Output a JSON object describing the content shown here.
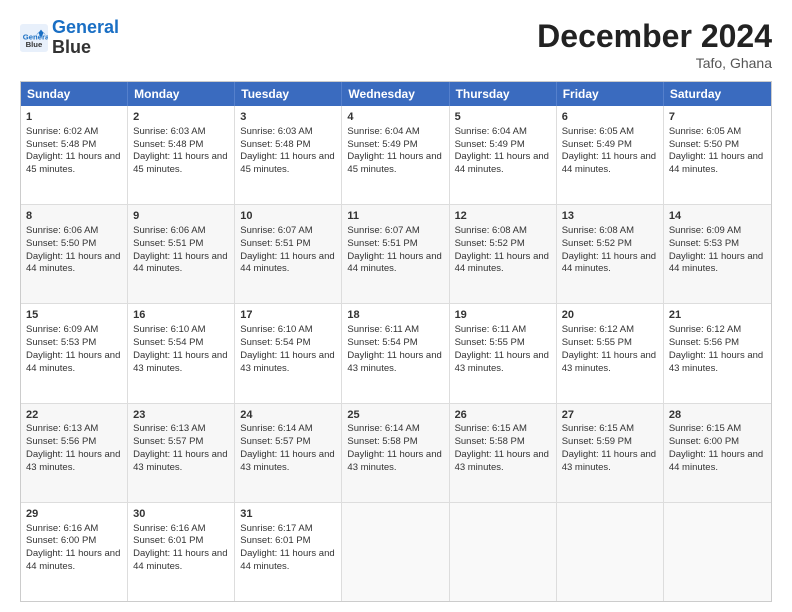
{
  "logo": {
    "line1": "General",
    "line2": "Blue"
  },
  "title": "December 2024",
  "location": "Tafo, Ghana",
  "days": [
    "Sunday",
    "Monday",
    "Tuesday",
    "Wednesday",
    "Thursday",
    "Friday",
    "Saturday"
  ],
  "weeks": [
    [
      {
        "day": 1,
        "rise": "6:02 AM",
        "set": "5:48 PM",
        "hours": "11 hours and 45 minutes."
      },
      {
        "day": 2,
        "rise": "6:03 AM",
        "set": "5:48 PM",
        "hours": "11 hours and 45 minutes."
      },
      {
        "day": 3,
        "rise": "6:03 AM",
        "set": "5:48 PM",
        "hours": "11 hours and 45 minutes."
      },
      {
        "day": 4,
        "rise": "6:04 AM",
        "set": "5:49 PM",
        "hours": "11 hours and 45 minutes."
      },
      {
        "day": 5,
        "rise": "6:04 AM",
        "set": "5:49 PM",
        "hours": "11 hours and 44 minutes."
      },
      {
        "day": 6,
        "rise": "6:05 AM",
        "set": "5:49 PM",
        "hours": "11 hours and 44 minutes."
      },
      {
        "day": 7,
        "rise": "6:05 AM",
        "set": "5:50 PM",
        "hours": "11 hours and 44 minutes."
      }
    ],
    [
      {
        "day": 8,
        "rise": "6:06 AM",
        "set": "5:50 PM",
        "hours": "11 hours and 44 minutes."
      },
      {
        "day": 9,
        "rise": "6:06 AM",
        "set": "5:51 PM",
        "hours": "11 hours and 44 minutes."
      },
      {
        "day": 10,
        "rise": "6:07 AM",
        "set": "5:51 PM",
        "hours": "11 hours and 44 minutes."
      },
      {
        "day": 11,
        "rise": "6:07 AM",
        "set": "5:51 PM",
        "hours": "11 hours and 44 minutes."
      },
      {
        "day": 12,
        "rise": "6:08 AM",
        "set": "5:52 PM",
        "hours": "11 hours and 44 minutes."
      },
      {
        "day": 13,
        "rise": "6:08 AM",
        "set": "5:52 PM",
        "hours": "11 hours and 44 minutes."
      },
      {
        "day": 14,
        "rise": "6:09 AM",
        "set": "5:53 PM",
        "hours": "11 hours and 44 minutes."
      }
    ],
    [
      {
        "day": 15,
        "rise": "6:09 AM",
        "set": "5:53 PM",
        "hours": "11 hours and 44 minutes."
      },
      {
        "day": 16,
        "rise": "6:10 AM",
        "set": "5:54 PM",
        "hours": "11 hours and 43 minutes."
      },
      {
        "day": 17,
        "rise": "6:10 AM",
        "set": "5:54 PM",
        "hours": "11 hours and 43 minutes."
      },
      {
        "day": 18,
        "rise": "6:11 AM",
        "set": "5:54 PM",
        "hours": "11 hours and 43 minutes."
      },
      {
        "day": 19,
        "rise": "6:11 AM",
        "set": "5:55 PM",
        "hours": "11 hours and 43 minutes."
      },
      {
        "day": 20,
        "rise": "6:12 AM",
        "set": "5:55 PM",
        "hours": "11 hours and 43 minutes."
      },
      {
        "day": 21,
        "rise": "6:12 AM",
        "set": "5:56 PM",
        "hours": "11 hours and 43 minutes."
      }
    ],
    [
      {
        "day": 22,
        "rise": "6:13 AM",
        "set": "5:56 PM",
        "hours": "11 hours and 43 minutes."
      },
      {
        "day": 23,
        "rise": "6:13 AM",
        "set": "5:57 PM",
        "hours": "11 hours and 43 minutes."
      },
      {
        "day": 24,
        "rise": "6:14 AM",
        "set": "5:57 PM",
        "hours": "11 hours and 43 minutes."
      },
      {
        "day": 25,
        "rise": "6:14 AM",
        "set": "5:58 PM",
        "hours": "11 hours and 43 minutes."
      },
      {
        "day": 26,
        "rise": "6:15 AM",
        "set": "5:58 PM",
        "hours": "11 hours and 43 minutes."
      },
      {
        "day": 27,
        "rise": "6:15 AM",
        "set": "5:59 PM",
        "hours": "11 hours and 43 minutes."
      },
      {
        "day": 28,
        "rise": "6:15 AM",
        "set": "6:00 PM",
        "hours": "11 hours and 44 minutes."
      }
    ],
    [
      {
        "day": 29,
        "rise": "6:16 AM",
        "set": "6:00 PM",
        "hours": "11 hours and 44 minutes."
      },
      {
        "day": 30,
        "rise": "6:16 AM",
        "set": "6:01 PM",
        "hours": "11 hours and 44 minutes."
      },
      {
        "day": 31,
        "rise": "6:17 AM",
        "set": "6:01 PM",
        "hours": "11 hours and 44 minutes."
      },
      null,
      null,
      null,
      null
    ]
  ]
}
